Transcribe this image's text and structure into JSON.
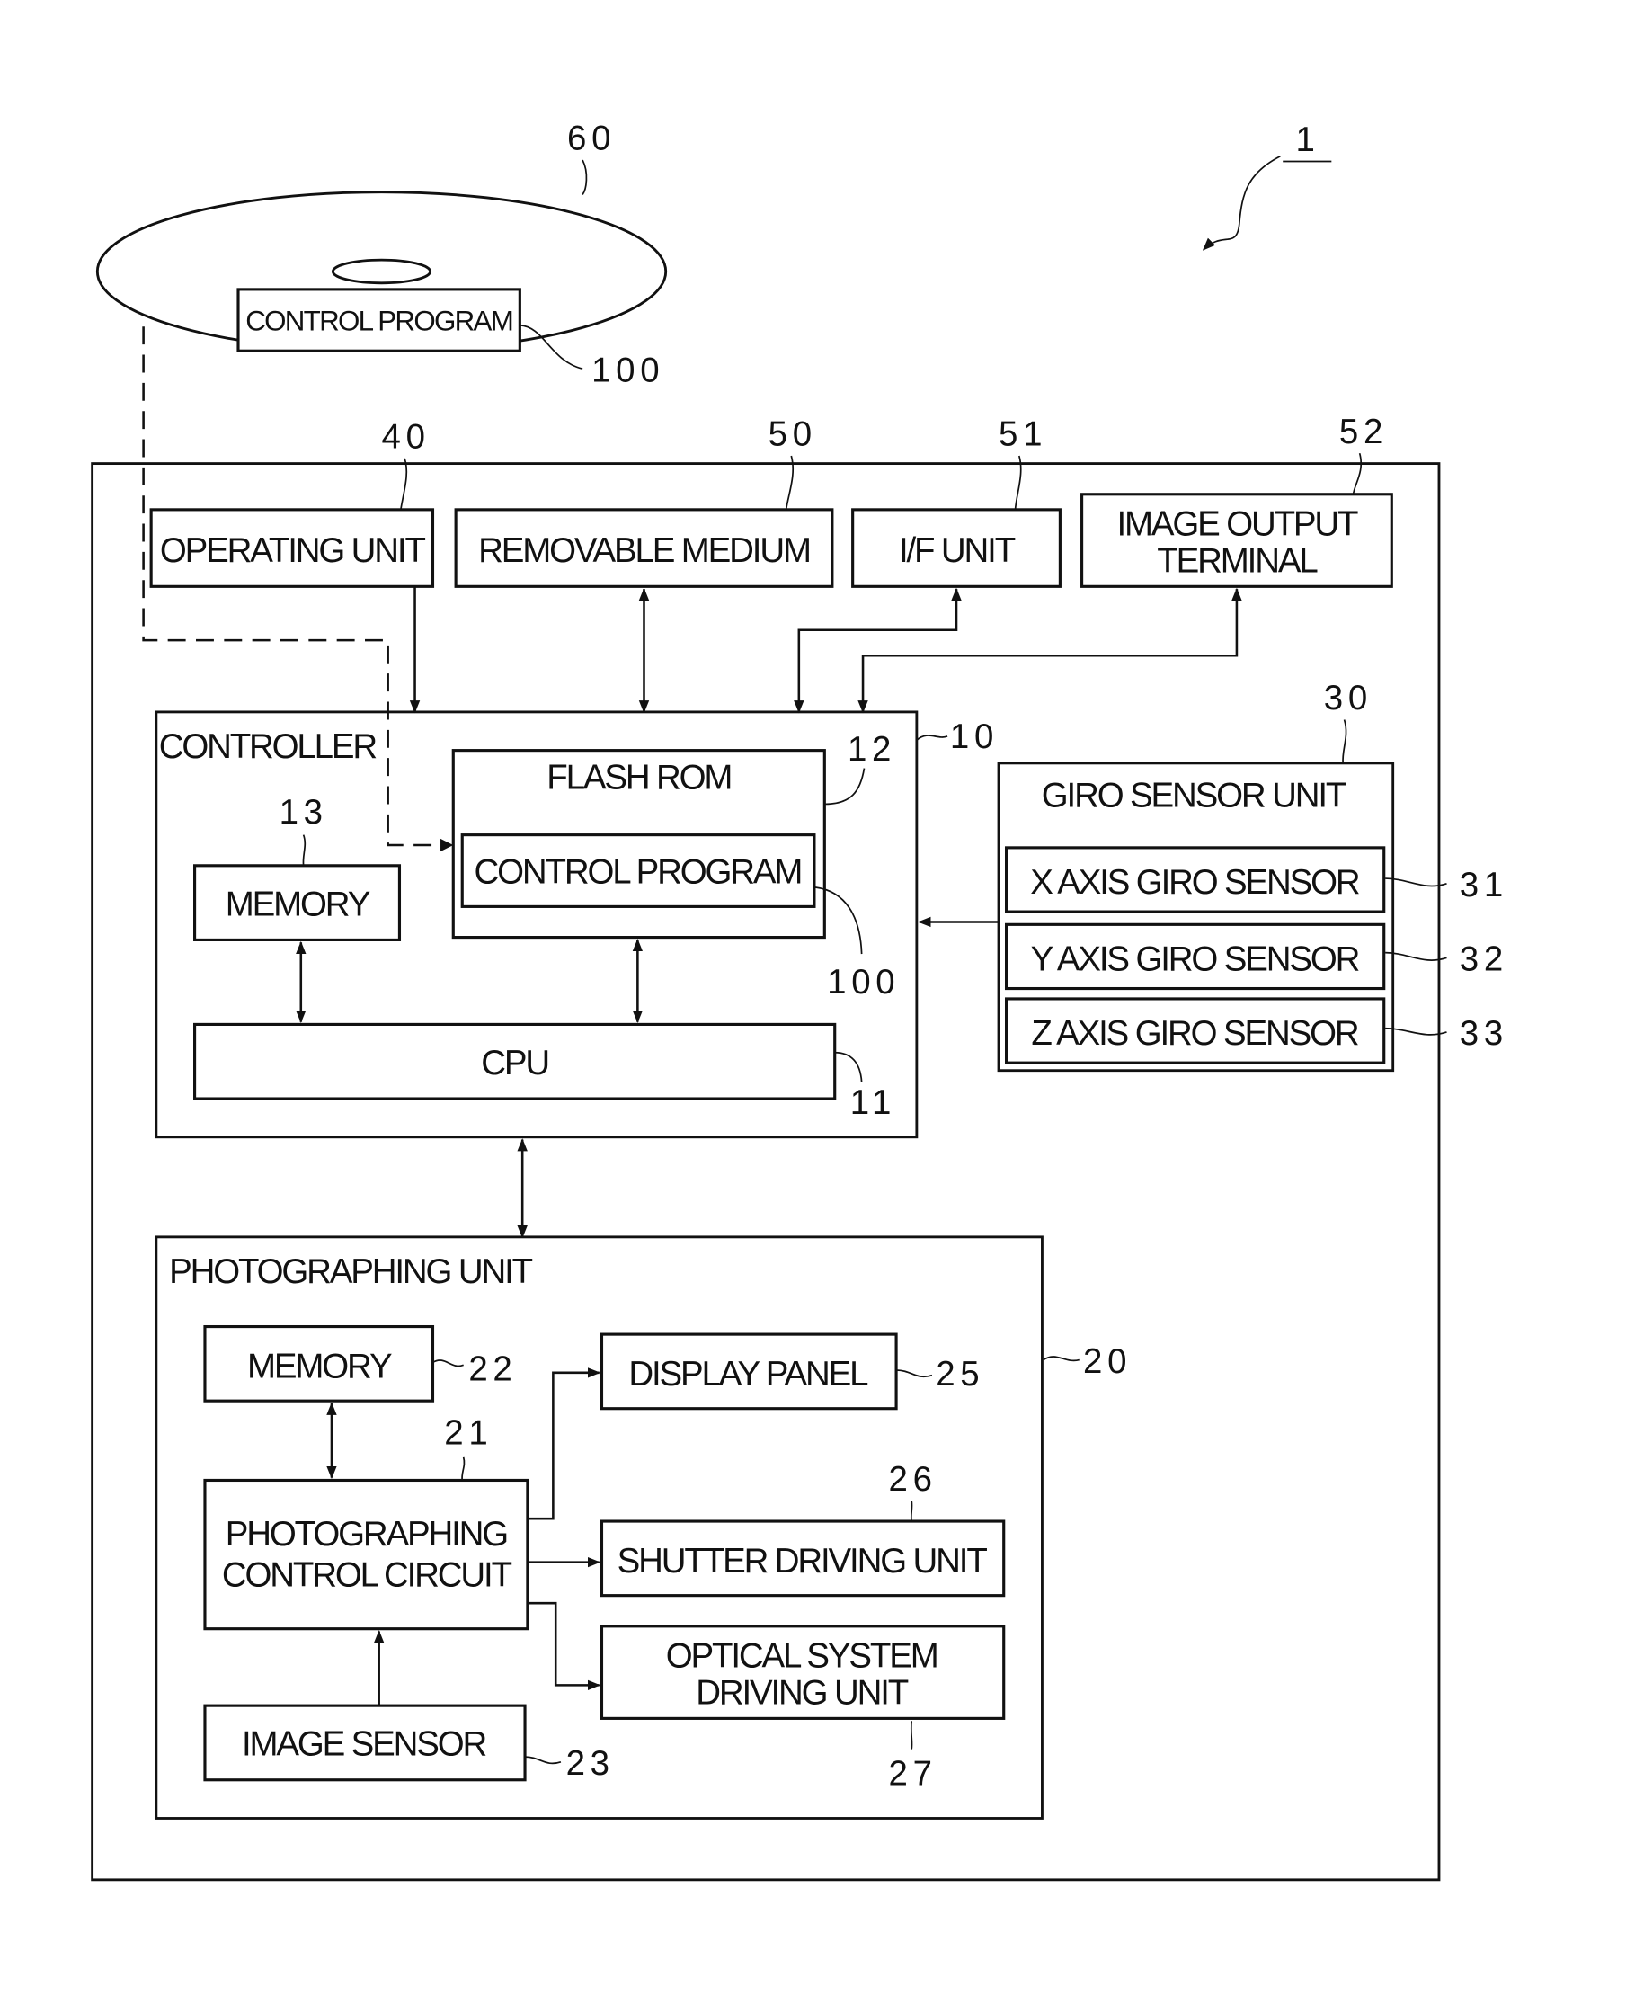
{
  "figure": {
    "ref_device": "1",
    "disc": {
      "ref": "60",
      "program_label": "CONTROL PROGRAM",
      "program_ref": "100"
    },
    "top_blocks": [
      {
        "ref": "40",
        "label": "OPERATING UNIT"
      },
      {
        "ref": "50",
        "label": "REMOVABLE MEDIUM"
      },
      {
        "ref": "51",
        "label": "I/F UNIT"
      },
      {
        "ref": "52",
        "label_line1": "IMAGE OUTPUT",
        "label_line2": "TERMINAL"
      }
    ],
    "controller": {
      "ref": "10",
      "title": "CONTROLLER",
      "flash_rom": {
        "ref": "12",
        "label": "FLASH ROM",
        "program_label": "CONTROL PROGRAM",
        "program_ref": "100"
      },
      "memory": {
        "ref": "13",
        "label": "MEMORY"
      },
      "cpu": {
        "ref": "11",
        "label": "CPU"
      }
    },
    "giro": {
      "ref": "30",
      "title": "GIRO SENSOR UNIT",
      "sensors": [
        {
          "ref": "31",
          "label": "X AXIS GIRO SENSOR"
        },
        {
          "ref": "32",
          "label": "Y AXIS GIRO SENSOR"
        },
        {
          "ref": "33",
          "label": "Z AXIS GIRO SENSOR"
        }
      ]
    },
    "photographing": {
      "ref": "20",
      "title": "PHOTOGRAPHING UNIT",
      "memory": {
        "ref": "22",
        "label": "MEMORY"
      },
      "control_circuit": {
        "ref": "21",
        "label_line1": "PHOTOGRAPHING",
        "label_line2": "CONTROL CIRCUIT"
      },
      "image_sensor": {
        "ref": "23",
        "label": "IMAGE SENSOR"
      },
      "display_panel": {
        "ref": "25",
        "label": "DISPLAY PANEL"
      },
      "shutter": {
        "ref": "26",
        "label": "SHUTTER DRIVING UNIT"
      },
      "optical": {
        "ref": "27",
        "label_line1": "OPTICAL SYSTEM",
        "label_line2": "DRIVING UNIT"
      }
    }
  }
}
